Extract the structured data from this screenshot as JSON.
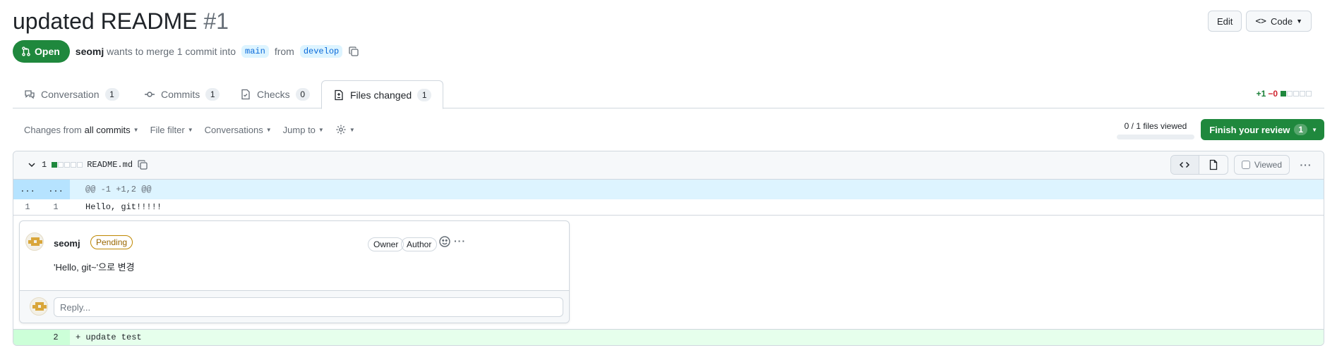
{
  "pr": {
    "title": "updated README",
    "number": "#1",
    "state": "Open",
    "author": "seomj",
    "merge_text": "wants to merge 1 commit into",
    "base_branch": "main",
    "from_text": "from",
    "head_branch": "develop"
  },
  "header_actions": {
    "edit": "Edit",
    "code": "Code"
  },
  "tabs": [
    {
      "label": "Conversation",
      "count": "1"
    },
    {
      "label": "Commits",
      "count": "1"
    },
    {
      "label": "Checks",
      "count": "0"
    },
    {
      "label": "Files changed",
      "count": "1",
      "active": true
    }
  ],
  "diffstat": {
    "additions": "+1",
    "deletions": "−0"
  },
  "toolbar": {
    "changes_prefix": "Changes from",
    "changes_value": "all commits",
    "file_filter": "File filter",
    "conversations": "Conversations",
    "jump_to": "Jump to",
    "viewed_progress": "0 / 1 files viewed",
    "finish_review": "Finish your review",
    "finish_count": "1"
  },
  "file": {
    "changes_count": "1",
    "name": "README.md",
    "viewed_label": "Viewed",
    "hunk_left": "...",
    "hunk_right": "...",
    "hunk_header": "@@ -1 +1,2 @@",
    "lines": [
      {
        "old": "1",
        "new": "1",
        "code": "Hello, git!!!!!"
      },
      {
        "old": "",
        "new": "2",
        "code": "+ update test"
      }
    ]
  },
  "comment": {
    "author": "seomj",
    "status": "Pending",
    "roles": [
      "Owner",
      "Author"
    ],
    "body": "'Hello, git~'으로 변경",
    "reply_placeholder": "Reply..."
  },
  "colors": {
    "open_green": "#1f883d",
    "link_blue": "#0969da",
    "hunk_blue": "#ddf4ff",
    "add_green": "#e6ffec"
  }
}
